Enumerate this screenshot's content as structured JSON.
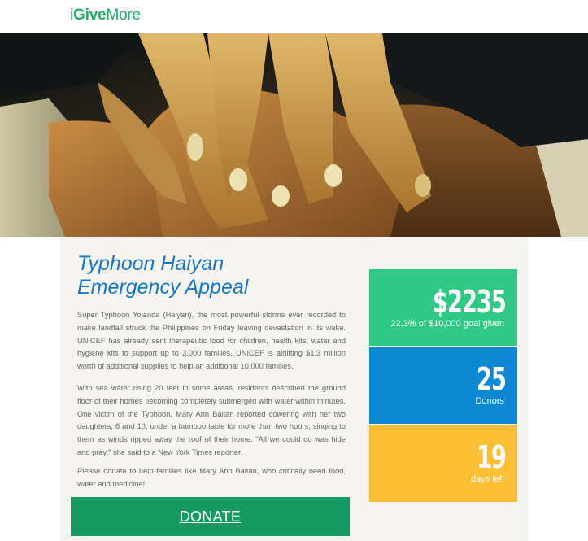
{
  "brand": {
    "part1": "i",
    "part2": "Give",
    "part3": "More",
    "color": "#1fae6a"
  },
  "hero": {
    "description_icon": "hands-photo"
  },
  "appeal": {
    "title_line1": "Typhoon Haiyan",
    "title_line2": "Emergency Appeal",
    "paragraphs": [
      "Super Typhoon Yolanda (Haiyan), the most powerful storms ever recorded to make landfall struck the Philippines on Friday leaving devastation in its wake. UNICEF has already sent therapeutic food for children, health kits, water and hygiene kits to support up to 3,000 families.  UNICEF is airlifting $1.3 million worth of additional supplies to help an additional 10,000 families.",
      "With sea water rising 20 feet in some areas, residents described the ground floor of their homes becoming completely submerged with water within minutes.  One victim of the Typhoon, Mary Ann Baitan reported cowering with her two daughters, 6 and 10, under a bamboo table for more than two hours, singing to them as winds ripped away the roof of their home. \"All we could do was hide and pray,\" she said to  a New York Times reporter.",
      "Please donate to help families like Mary Ann Baitan, who critically need food, water and medicine!"
    ],
    "donate_label": "DONATE"
  },
  "stats": {
    "raised_amount": "$2235",
    "raised_label": "22.3% of $10,000 goal given",
    "goal_fraction": 0.223,
    "donors_count": "25",
    "donors_label": "Donors",
    "days_count": "19",
    "days_label": "days left"
  },
  "colors": {
    "title": "#1577c7",
    "donate": "#159a62",
    "stat_green": "#2fc884",
    "stat_blue": "#0d89d4",
    "stat_yellow": "#fbbe34"
  }
}
